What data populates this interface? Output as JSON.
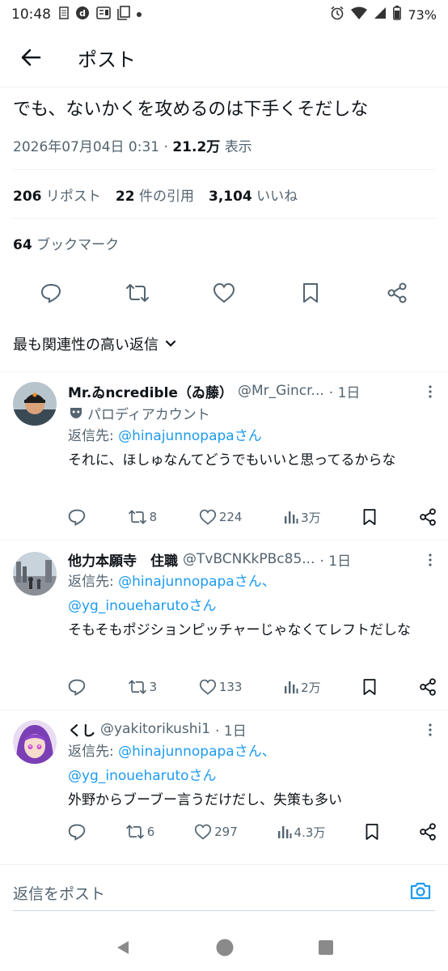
{
  "status_bar": {
    "time": "10:48",
    "battery": "73%",
    "icons_left": [
      "notification-icon",
      "d-app-icon",
      "news-icon",
      "screenshot-icon",
      "dot-icon"
    ],
    "icons_right": [
      "alarm-icon",
      "wifi-icon",
      "signal-icon",
      "battery-icon"
    ]
  },
  "header": {
    "title": "ポスト"
  },
  "tweet": {
    "text": "でも、ないかくを攻めるのは下手くそだしな",
    "datetime": "2026年07月04日 0:31",
    "views_count": "21.2万",
    "views_label": "表示",
    "retweets_count": "206",
    "retweets_label": "リポスト",
    "quotes_count": "22",
    "quotes_label": "件の引用",
    "likes_count": "3,104",
    "likes_label": "いいね",
    "bookmarks_count": "64",
    "bookmarks_label": "ブックマーク"
  },
  "sort": {
    "label": "最も関連性の高い返信"
  },
  "replies": [
    {
      "name": "Mr.ゐncredible（ゐ藤）",
      "handle": "@Mr_Gincr...",
      "time": "· 1日",
      "parody": "パロディアカウント",
      "replyto_prefix": "返信先:",
      "replyto_link": "@hinajunnopapaさん",
      "replyto_link2": "",
      "text": "それに、ほしゅなんてどうでもいいと思ってるからな",
      "retweets": "8",
      "likes": "224",
      "views": "3万"
    },
    {
      "name": "他力本願寺　住職",
      "handle": "@TvBCNKkPBc85...",
      "time": "· 1日",
      "replyto_prefix": "返信先:",
      "replyto_link": "@hinajunnopapaさん、",
      "replyto_link2": "@yg_inoueharutoさん",
      "text": "そもそもポジションピッチャーじゃなくてレフトだしな",
      "retweets": "3",
      "likes": "133",
      "views": "2万"
    },
    {
      "name": "くし",
      "handle": "@yakitorikushi1",
      "time": "· 1日",
      "replyto_prefix": "返信先:",
      "replyto_link": "@hinajunnopapaさん、",
      "replyto_link2": "@yg_inoueharutoさん",
      "text": "外野からブーブー言うだけだし、失策も多い",
      "retweets": "6",
      "likes": "297",
      "views": "4.3万"
    }
  ],
  "composer": {
    "placeholder": "返信をポスト"
  },
  "colors": {
    "accent": "#1d9bf0",
    "text": "#0f1419",
    "muted": "#536471",
    "border": "#eff3f4"
  }
}
